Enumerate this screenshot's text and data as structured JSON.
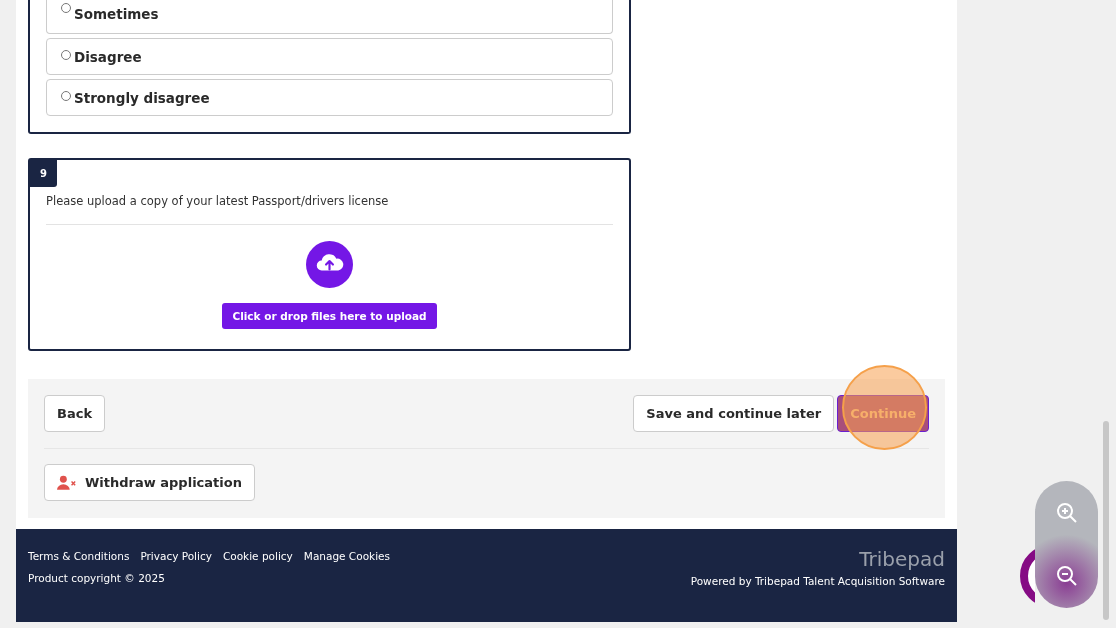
{
  "question_8": {
    "options": [
      {
        "label": "Sometimes",
        "selected": false
      },
      {
        "label": "Disagree",
        "selected": false
      },
      {
        "label": "Strongly disagree",
        "selected": false
      }
    ]
  },
  "question_9": {
    "number": "9",
    "prompt": "Please upload a copy of your latest Passport/drivers license",
    "upload_button": "Click or drop files here to upload"
  },
  "actions": {
    "back": "Back",
    "save": "Save and continue later",
    "continue": "Continue",
    "withdraw": "Withdraw application"
  },
  "footer": {
    "links": [
      "Terms & Conditions",
      "Privacy Policy",
      "Cookie policy",
      "Manage Cookies"
    ],
    "copyright": "Product copyright © 2025",
    "brand": "Tribepad",
    "powered_by": "Powered by Tribepad Talent Acquisition Software"
  }
}
